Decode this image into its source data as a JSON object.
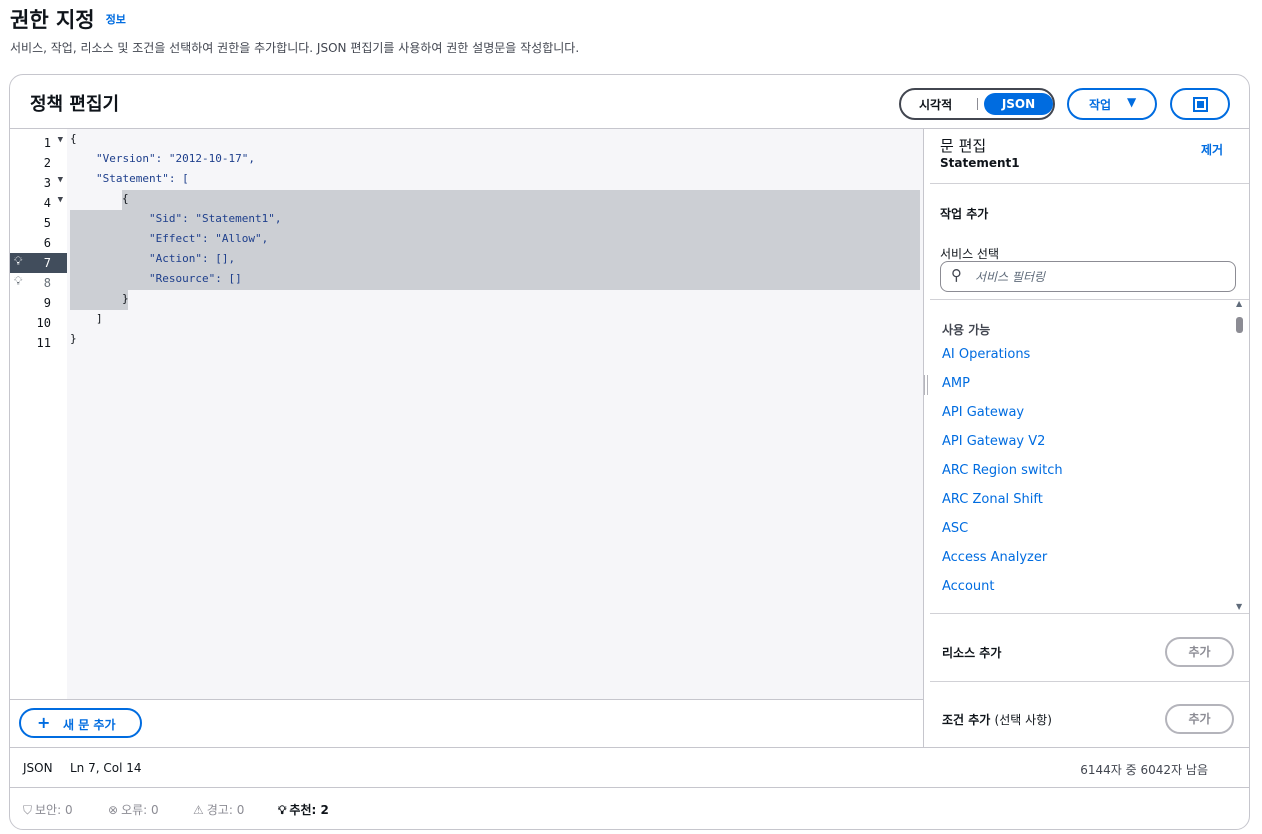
{
  "header": {
    "title": "권한 지정",
    "info_link": "정보",
    "description": "서비스, 작업, 리소스 및 조건을 선택하여 권한을 추가합니다. JSON 편집기를 사용하여 권한 설명문을 작성합니다."
  },
  "editor": {
    "title": "정책 편집기",
    "mode_toggle": {
      "visual_label": "시각적",
      "json_label": "JSON",
      "selected": "JSON"
    },
    "actions_button": "작업",
    "code_lines": [
      {
        "num": "1",
        "text": "{"
      },
      {
        "num": "2",
        "text": "\"Version\": \"2012-10-17\","
      },
      {
        "num": "3",
        "text": "\"Statement\": ["
      },
      {
        "num": "4",
        "text": "{"
      },
      {
        "num": "5",
        "text": "\"Sid\": \"Statement1\","
      },
      {
        "num": "6",
        "text": "\"Effect\": \"Allow\","
      },
      {
        "num": "7",
        "text": "\"Action\": [],"
      },
      {
        "num": "8",
        "text": "\"Resource\": []"
      },
      {
        "num": "9",
        "text": "}"
      },
      {
        "num": "10",
        "text": "]"
      },
      {
        "num": "11",
        "text": "}"
      }
    ],
    "add_statement_button": "새 문 추가"
  },
  "statement_panel": {
    "title": "문 편집",
    "statement_name": "Statement1",
    "remove_link": "제거",
    "add_actions_heading": "작업 추가",
    "service_select_label": "서비스 선택",
    "service_search_placeholder": "서비스 필터링",
    "available_heading": "사용 가능",
    "services": [
      "AI Operations",
      "AMP",
      "API Gateway",
      "API Gateway V2",
      "ARC Region switch",
      "ARC Zonal Shift",
      "ASC",
      "Access Analyzer",
      "Account"
    ],
    "add_resource_label": "리소스 추가",
    "add_resource_button": "추가",
    "add_condition_label": "조건 추가",
    "add_condition_optional": "(선택 사항)",
    "add_condition_button": "추가"
  },
  "status_bar": {
    "language": "JSON",
    "cursor": "Ln 7, Col 14",
    "char_count": "6144자 중 6042자 남음"
  },
  "checks": {
    "security": "보안: 0",
    "errors": "오류: 0",
    "warnings": "경고: 0",
    "suggestions": "추천: 2"
  },
  "colors": {
    "accent": "#006ce0",
    "active_line": "#414d5c",
    "selection": "#cccfd4"
  }
}
